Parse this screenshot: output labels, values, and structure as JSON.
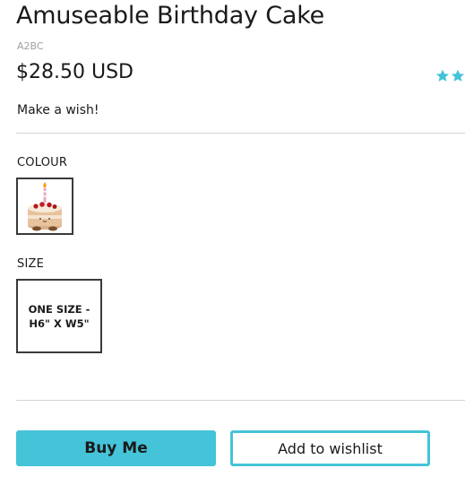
{
  "product": {
    "title": "Amuseable Birthday Cake",
    "sku": "A2BC",
    "price": "$28.50 USD",
    "tagline": "Make a wish!",
    "rating_stars_visible": 2
  },
  "options": {
    "colour_label": "COLOUR",
    "colour_swatch_icon": "birthday-cake-plush-thumbnail",
    "size_label": "SIZE",
    "size_value": "ONE SIZE -\nH6\" X W5\""
  },
  "actions": {
    "buy_label": "Buy Me",
    "wishlist_label": "Add to wishlist"
  },
  "colors": {
    "accent": "#45c3d8",
    "text": "#1a1a1a",
    "muted": "#a0a0a0",
    "divider": "#d6d6d6"
  }
}
